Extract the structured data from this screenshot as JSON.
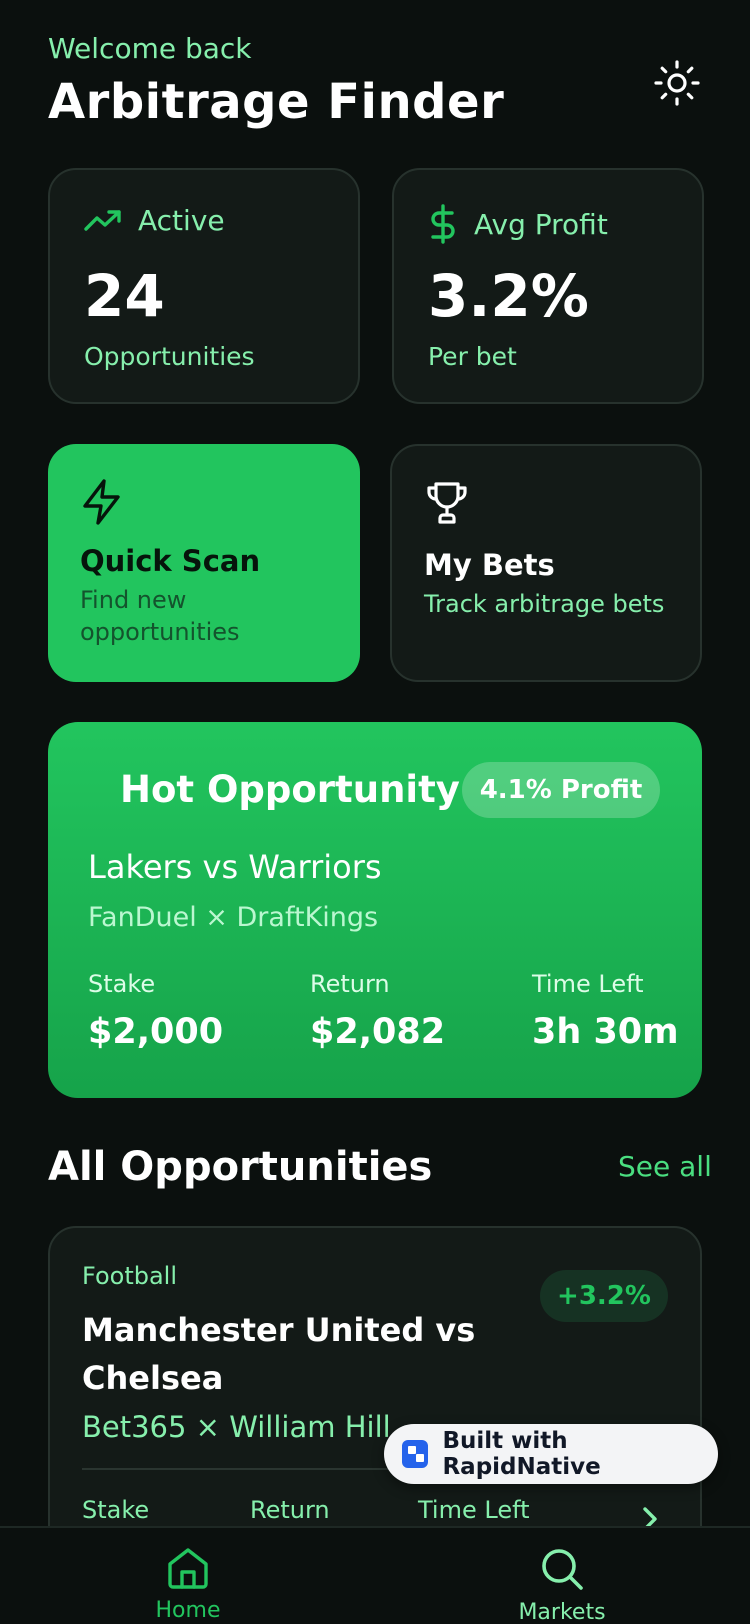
{
  "header": {
    "welcome": "Welcome back",
    "title": "Arbitrage Finder",
    "theme_icon": "sun-icon"
  },
  "stats": {
    "active": {
      "label": "Active",
      "value": "24",
      "sub": "Opportunities",
      "icon": "trending-up-icon"
    },
    "avg_profit": {
      "label": "Avg Profit",
      "value": "3.2%",
      "sub": "Per bet",
      "icon": "dollar-icon"
    }
  },
  "actions": {
    "quick_scan": {
      "title": "Quick Scan",
      "subtitle": "Find new opportunities",
      "icon": "lightning-icon"
    },
    "my_bets": {
      "title": "My Bets",
      "subtitle": "Track arbitrage bets",
      "icon": "trophy-icon"
    }
  },
  "hot": {
    "title": "Hot Opportunity",
    "badge": "4.1% Profit",
    "match": "Lakers vs Warriors",
    "books": "FanDuel × DraftKings",
    "stake_label": "Stake",
    "stake": "$2,000",
    "return_label": "Return",
    "return": "$2,082",
    "time_label": "Time Left",
    "time": "3h 30m"
  },
  "section": {
    "title": "All Opportunities",
    "see_all": "See all"
  },
  "opportunities": [
    {
      "category": "Football",
      "match": "Manchester United vs Chelsea",
      "books": "Bet365 × William Hill",
      "profit": "+3.2%",
      "stake_label": "Stake",
      "return_label": "Return",
      "time_label": "Time Left"
    }
  ],
  "badge": {
    "text": "Built with RapidNative"
  },
  "tabs": [
    {
      "label": "Home",
      "icon": "home-icon"
    },
    {
      "label": "Markets",
      "icon": "search-icon"
    }
  ],
  "colors": {
    "background": "#0b100e",
    "accent": "#22c55e",
    "accent_light": "#86efac",
    "card": "#131a17"
  }
}
